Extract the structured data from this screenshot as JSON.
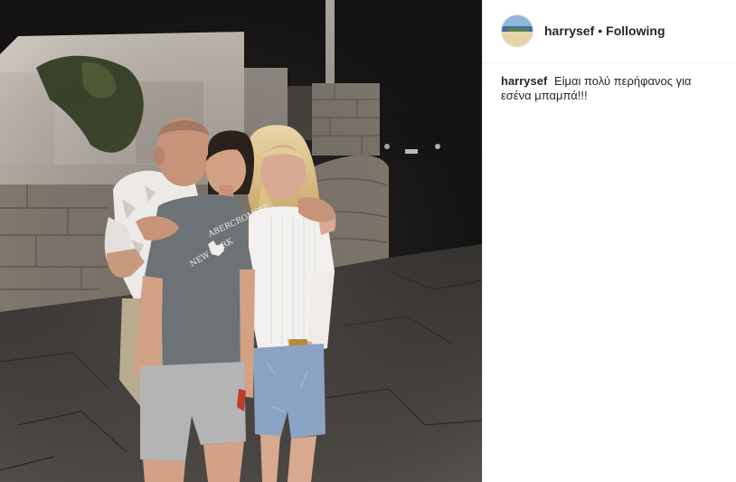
{
  "post": {
    "image_alt": "Photo of a family at night"
  },
  "header": {
    "username": "harrysef",
    "separator": "•",
    "follow_status": "Following"
  },
  "caption": {
    "username": "harrysef",
    "text": "Είμαι πολύ περήφανος για εσένα μπαμπά!!!"
  },
  "shirt_print": {
    "line1": "ABERCROMBIE",
    "line2": "NEW YORK"
  },
  "colors": {
    "text": "#262626",
    "border": "#efefef",
    "photo_bg": "#1b1a1a"
  },
  "icons": {
    "avatar": "beach-avatar-icon"
  }
}
